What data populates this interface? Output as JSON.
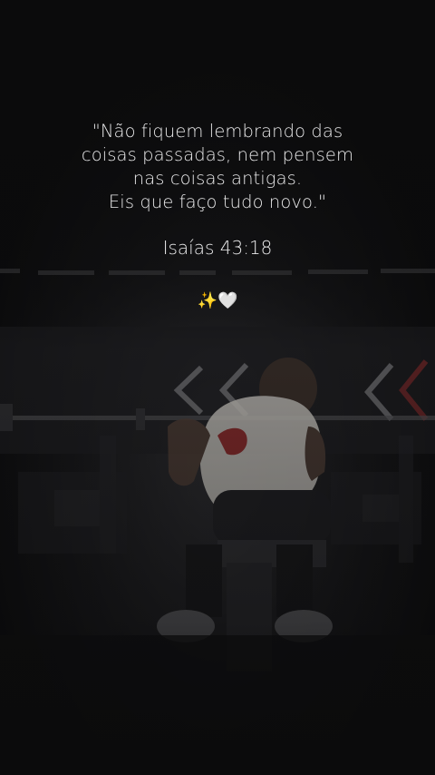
{
  "caption": {
    "quote_lines": [
      "\"Não fiquem lembrando das",
      "coisas passadas, nem pensem",
      "nas coisas antigas.",
      "Eis que faço tudo novo.\""
    ],
    "reference": "Isaías 43:18",
    "emoji_sparkles": "✨",
    "emoji_heart": "🤍"
  },
  "colors": {
    "background": "#0b0b0c",
    "text": "#e9e9ea",
    "accent_red": "#8e2a2a"
  }
}
